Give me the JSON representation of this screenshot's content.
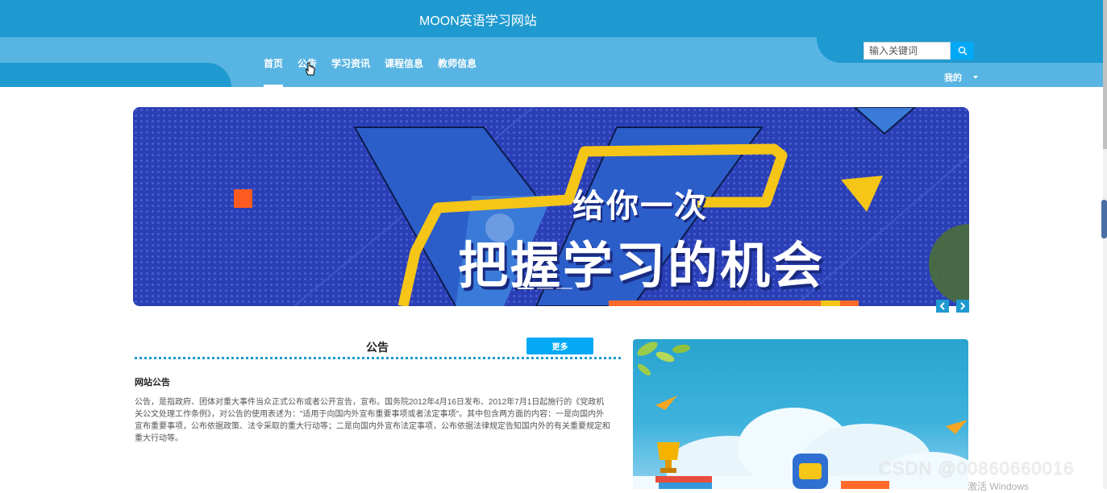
{
  "header": {
    "site_title": "MOON英语学习网站",
    "nav_items": [
      {
        "label": "首页",
        "active": true
      },
      {
        "label": "公告",
        "active": false
      },
      {
        "label": "学习资讯",
        "active": false
      },
      {
        "label": "课程信息",
        "active": false
      },
      {
        "label": "教师信息",
        "active": false
      }
    ],
    "search": {
      "placeholder": "输入关键词",
      "icon": "search-icon"
    },
    "user_menu": {
      "label": "我的",
      "icon": "caret-down-icon"
    }
  },
  "banner": {
    "line1": "给你一次",
    "line2": "把握学习的机会",
    "slides": [
      {
        "active": true
      },
      {
        "active": false
      },
      {
        "active": false
      }
    ],
    "prev_icon": "chevron-left-icon",
    "next_icon": "chevron-right-icon"
  },
  "notice": {
    "title": "公告",
    "more_label": "更多",
    "heading": "网站公告",
    "body": "公告，是指政府、团体对重大事件当众正式公布或者公开宣告，宣布。国务院2012年4月16日发布、2012年7月1日起施行的《党政机关公文处理工作条例》，对公告的使用表述为：\"适用于向国内外宣布重要事项或者法定事项\"。其中包含两方面的内容：一是向国内外宣布重要事项，公布依据政策、法令采取的重大行动等；二是向国内外宣布法定事项，公布依据法律规定告知国内外的有关重要规定和重大行动等。"
  },
  "overlay": {
    "watermark": "CSDN @00860660016",
    "windows_text": "激活 Windows"
  },
  "colors": {
    "primary": "#1f9ad0",
    "nav_bg": "#58b4e2",
    "accent": "#03a9f4",
    "banner_bg": "#2a3fb5",
    "ribbon": "#f5c518"
  }
}
